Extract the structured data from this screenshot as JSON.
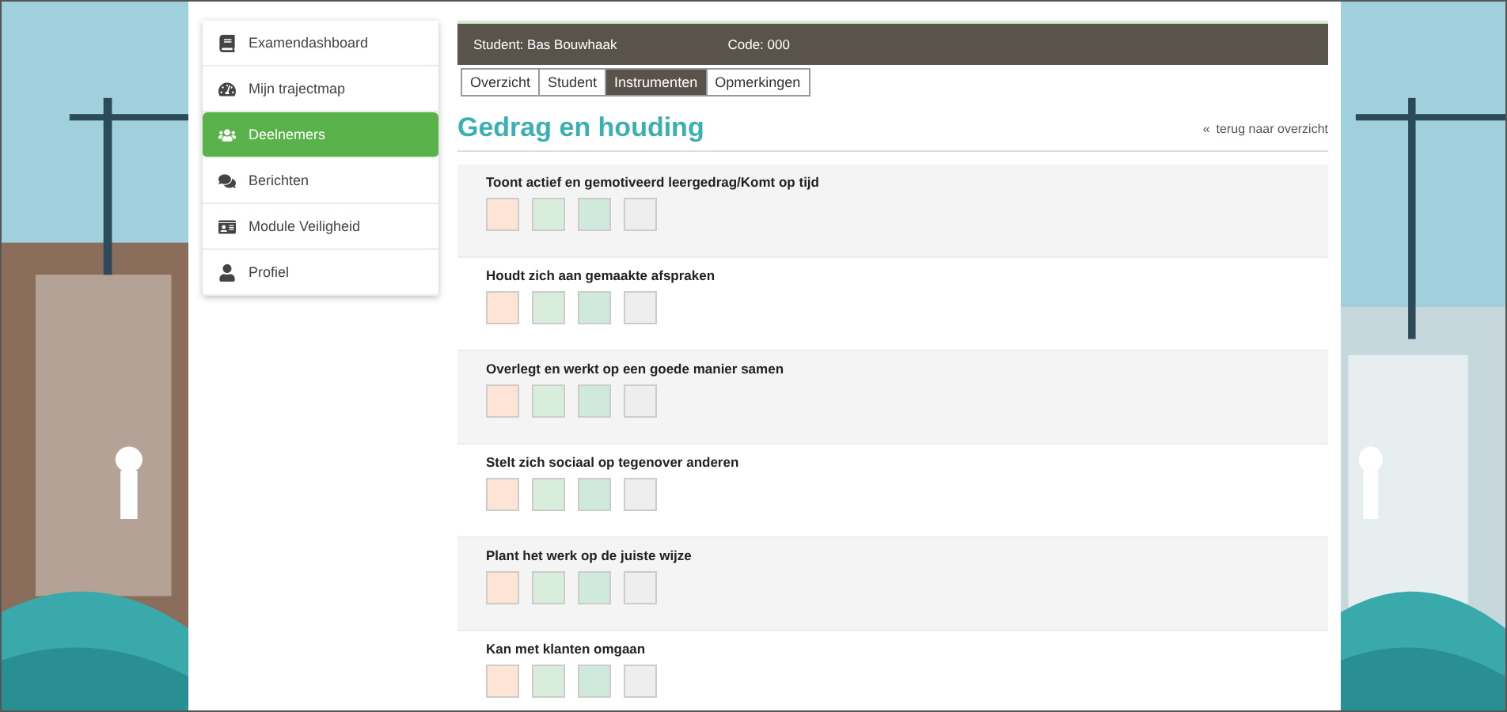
{
  "sidebar": {
    "items": [
      {
        "label": "Examendashboard",
        "selected": false
      },
      {
        "label": "Mijn trajectmap",
        "selected": false
      },
      {
        "label": "Deelnemers",
        "selected": true
      },
      {
        "label": "Berichten",
        "selected": false
      },
      {
        "label": "Module Veiligheid",
        "selected": false
      },
      {
        "label": "Profiel",
        "selected": false
      }
    ]
  },
  "header": {
    "student": "Student: Bas Bouwhaak",
    "code": "Code: 000"
  },
  "tabs": [
    {
      "label": "Overzicht",
      "selected": false
    },
    {
      "label": "Student",
      "selected": false
    },
    {
      "label": "Instrumenten",
      "selected": true
    },
    {
      "label": "Opmerkingen",
      "selected": false
    }
  ],
  "page_title": "Gedrag en houding",
  "back_link": {
    "icon": "«",
    "label": "terug naar overzicht"
  },
  "criteria": [
    {
      "label": "Toont actief en gemotiveerd leergedrag/Komt op tijd",
      "options": [
        {
          "color": "#fde4d4"
        },
        {
          "color": "#d8eddb"
        },
        {
          "color": "#cfe9dd"
        },
        {
          "color": "#eeeeee"
        }
      ]
    },
    {
      "label": "Houdt zich aan gemaakte afspraken",
      "options": [
        {
          "color": "#fde4d4"
        },
        {
          "color": "#d8eddb"
        },
        {
          "color": "#cfe9dd"
        },
        {
          "color": "#eeeeee"
        }
      ]
    },
    {
      "label": "Overlegt en werkt op een goede manier samen",
      "options": [
        {
          "color": "#fde4d4"
        },
        {
          "color": "#d8eddb"
        },
        {
          "color": "#cfe9dd"
        },
        {
          "color": "#eeeeee"
        }
      ]
    },
    {
      "label": "Stelt zich sociaal op tegenover anderen",
      "options": [
        {
          "color": "#fde4d4"
        },
        {
          "color": "#d8eddb"
        },
        {
          "color": "#cfe9dd"
        },
        {
          "color": "#eeeeee"
        }
      ]
    },
    {
      "label": "Plant het werk op de juiste wijze",
      "options": [
        {
          "color": "#fde4d4"
        },
        {
          "color": "#d8eddb"
        },
        {
          "color": "#cfe9dd"
        },
        {
          "color": "#eeeeee"
        }
      ]
    },
    {
      "label": "Kan met klanten omgaan",
      "options": [
        {
          "color": "#fde4d4"
        },
        {
          "color": "#d8eddb"
        },
        {
          "color": "#cfe9dd"
        },
        {
          "color": "#eeeeee"
        }
      ]
    }
  ]
}
